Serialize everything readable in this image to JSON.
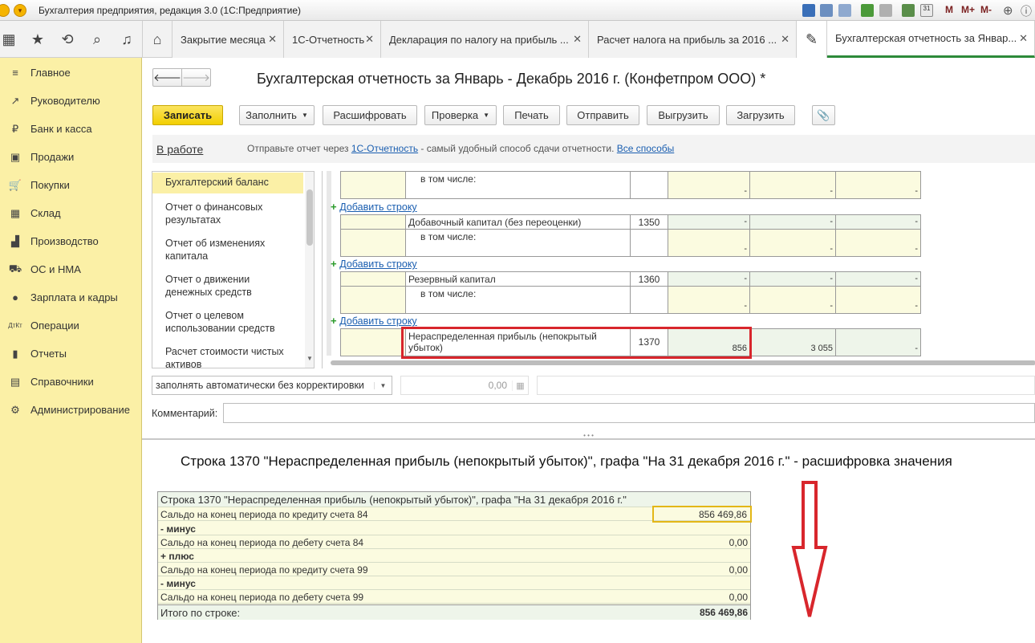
{
  "window": {
    "title": "Бухгалтерия предприятия, редакция 3.0 (1С:Предприятие)",
    "right_buttons": [
      "M",
      "M+",
      "M-"
    ]
  },
  "tabs": [
    {
      "label": "Закрытие месяца",
      "close": "✕"
    },
    {
      "label": "1С-Отчетность",
      "close": "✕"
    },
    {
      "label": "Декларация по налогу на прибыль ...",
      "close": "✕"
    },
    {
      "label": "Расчет налога на прибыль за 2016 ...",
      "close": "✕"
    },
    {
      "label": "Бухгалтерская отчетность за Январ...",
      "close": "✕"
    }
  ],
  "sidebar": {
    "items": [
      {
        "label": "Главное",
        "icon": "≡"
      },
      {
        "label": "Руководителю",
        "icon": "↗"
      },
      {
        "label": "Банк и касса",
        "icon": "₽"
      },
      {
        "label": "Продажи",
        "icon": "▣"
      },
      {
        "label": "Покупки",
        "icon": "🛒"
      },
      {
        "label": "Склад",
        "icon": "▦"
      },
      {
        "label": "Производство",
        "icon": "▟"
      },
      {
        "label": "ОС и НМА",
        "icon": "⛟"
      },
      {
        "label": "Зарплата и кадры",
        "icon": "●"
      },
      {
        "label": "Операции",
        "icon": "ДтКт"
      },
      {
        "label": "Отчеты",
        "icon": "▮"
      },
      {
        "label": "Справочники",
        "icon": "▤"
      },
      {
        "label": "Администрирование",
        "icon": "⚙"
      }
    ]
  },
  "form": {
    "title": "Бухгалтерская отчетность за Январь - Декабрь 2016 г. (Конфетпром ООО) *",
    "toolbar": {
      "save": "Записать",
      "fill": "Заполнить",
      "decode": "Расшифровать",
      "check": "Проверка",
      "print": "Печать",
      "send": "Отправить",
      "export": "Выгрузить",
      "import": "Загрузить"
    },
    "status": {
      "state": "В работе",
      "prefix": "Отправьте отчет через ",
      "link1": "1С-Отчетность",
      "middle": " - самый удобный способ сдачи отчетности. ",
      "link2": "Все способы"
    },
    "tree": [
      "Бухгалтерский баланс",
      "Отчет о финансовых результатах",
      "Отчет об изменениях капитала",
      "Отчет о движении денежных средств",
      "Отчет о целевом использовании средств",
      "Расчет стоимости чистых активов"
    ],
    "grid": {
      "including": "в том числе:",
      "add_row": "Добавить строку",
      "dash": "-",
      "r1350": {
        "name": "Добавочный капитал (без переоценки)",
        "code": "1350"
      },
      "r1360": {
        "name": "Резервный капитал",
        "code": "1360"
      },
      "r1370": {
        "name": "Нераспределенная прибыль (непокрытый убыток)",
        "code": "1370",
        "v1": "856",
        "v2": "3 055"
      }
    },
    "fill_mode": "заполнять автоматически без корректировки",
    "amount": "0,00",
    "comment_label": "Комментарий:"
  },
  "decode": {
    "heading": "Строка 1370 \"Нераспределенная прибыль (непокрытый убыток)\", графа \"На 31 декабря 2016 г.\" - расшифровка значения",
    "table_title": "Строка 1370 \"Нераспределенная прибыль (непокрытый убыток)\", графа \"На 31 декабря 2016 г.\"",
    "rows": [
      {
        "label": "Сальдо на конец периода по кредиту счета 84",
        "value": "856 469,86"
      },
      {
        "label": "- минус",
        "value": ""
      },
      {
        "label": "Сальдо на конец периода по дебету счета 84",
        "value": "0,00"
      },
      {
        "label": "+ плюс",
        "value": ""
      },
      {
        "label": "Сальдо на конец периода по кредиту счета 99",
        "value": "0,00"
      },
      {
        "label": "- минус",
        "value": ""
      },
      {
        "label": "Сальдо на конец периода по дебету счета 99",
        "value": "0,00"
      }
    ],
    "total_label": "Итого по строке:",
    "total_value": "856 469,86"
  },
  "colors": {
    "sidebar": "#fbf0a6",
    "save_button": "#f5d400",
    "highlight": "#d8262c"
  }
}
